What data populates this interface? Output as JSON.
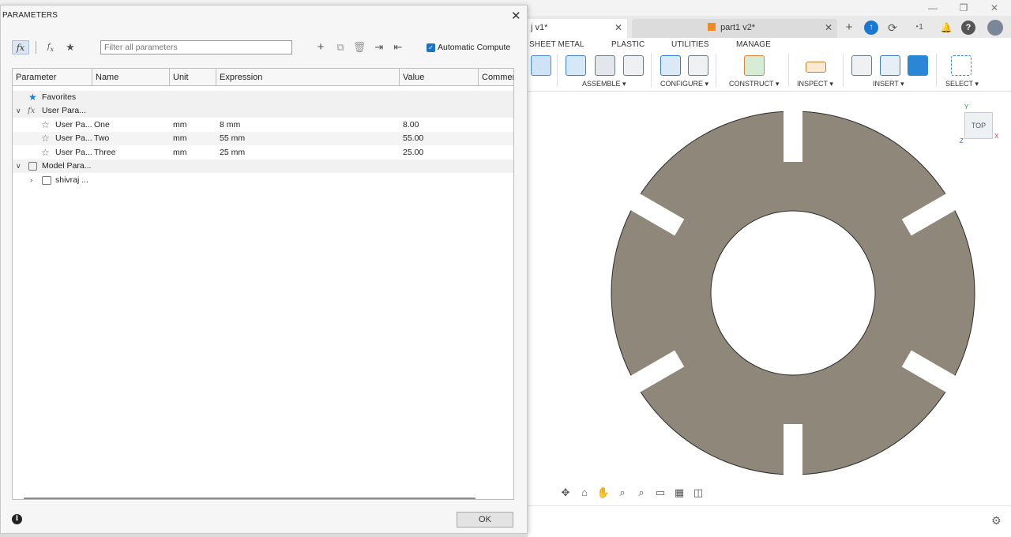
{
  "app": {
    "tabs": [
      {
        "label": "j v1*",
        "active": true
      },
      {
        "label": "part1 v2*",
        "active": false
      }
    ],
    "notification_count": "1",
    "ribbon": {
      "tabs": [
        "SHEET METAL",
        "PLASTIC",
        "UTILITIES",
        "MANAGE"
      ],
      "groups": [
        "ASSEMBLE ▾",
        "CONFIGURE ▾",
        "CONSTRUCT ▾",
        "INSPECT ▾",
        "INSERT ▾",
        "SELECT ▾"
      ]
    },
    "viewcube_label": "TOP",
    "axis_labels": {
      "y": "Y",
      "x": "X",
      "z": "Z"
    }
  },
  "dialog": {
    "title": "PARAMETERS",
    "filter_placeholder": "Filter all parameters",
    "auto_compute_label": "Automatic Compute",
    "columns": [
      "Parameter",
      "Name",
      "Unit",
      "Expression",
      "Value",
      "Commen"
    ],
    "rows": {
      "favorites": "Favorites",
      "user_group": "User Para...",
      "user_params": [
        {
          "parameter": "User Pa...",
          "name": "One",
          "unit": "mm",
          "expression": "8 mm",
          "value": "8.00"
        },
        {
          "parameter": "User Pa...",
          "name": "Two",
          "unit": "mm",
          "expression": "55 mm",
          "value": "55.00"
        },
        {
          "parameter": "User Pa...",
          "name": "Three",
          "unit": "mm",
          "expression": "25 mm",
          "value": "25.00"
        }
      ],
      "model_group": "Model Para...",
      "model_child": "shivraj ..."
    },
    "ok_label": "OK"
  },
  "colors": {
    "part_fill": "#8f887a",
    "accent_blue": "#1a73c9",
    "star_blue": "#1a7fd0"
  },
  "icons": [
    "fx-icon",
    "add-parameter-icon",
    "favorite-star-icon",
    "plus-icon",
    "copy-icon",
    "delete-icon",
    "import-icon",
    "export-icon",
    "info-icon",
    "close-icon"
  ]
}
